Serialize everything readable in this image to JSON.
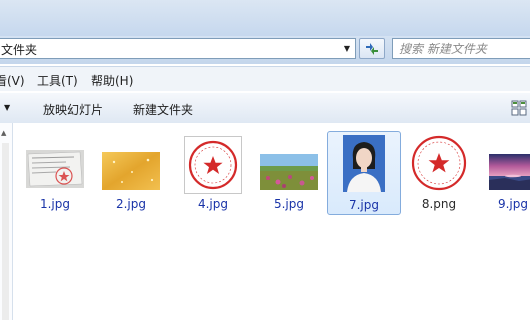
{
  "address": {
    "path": "文件夹"
  },
  "search": {
    "placeholder": "搜索 新建文件夹"
  },
  "menu": [
    {
      "label": "看(V)"
    },
    {
      "label": "工具(T)"
    },
    {
      "label": "帮助(H)"
    }
  ],
  "toolbar": {
    "slideshow_label": "放映幻灯片",
    "new_folder_label": "新建文件夹"
  },
  "files": [
    {
      "name": "1.jpg",
      "thumb": "document-photo"
    },
    {
      "name": "2.jpg",
      "thumb": "gold-texture"
    },
    {
      "name": "4.jpg",
      "thumb": "red-seal"
    },
    {
      "name": "5.jpg",
      "thumb": "landscape"
    },
    {
      "name": "7.jpg",
      "thumb": "portrait",
      "selected": true
    },
    {
      "name": "8.png",
      "thumb": "red-seal"
    },
    {
      "name": "9.jpg",
      "thumb": "sunset-sea"
    }
  ],
  "colors": {
    "filename": "#1a34a8",
    "selection": "#84acdd",
    "seal": "#d42a2a"
  }
}
